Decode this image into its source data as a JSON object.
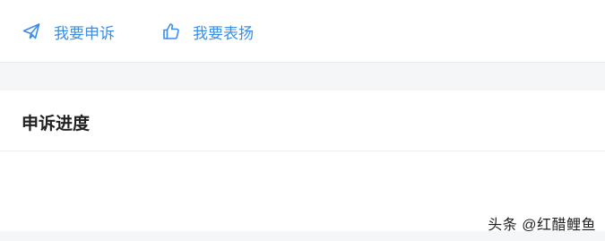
{
  "actions": {
    "complain_label": "我要申诉",
    "praise_label": "我要表扬",
    "complain_icon": "paper-plane-icon",
    "praise_icon": "thumbs-up-icon",
    "accent_color": "#3a8ee6"
  },
  "progress": {
    "title": "申诉进度"
  },
  "watermark": {
    "text": "头条 @红醋鲤鱼"
  }
}
